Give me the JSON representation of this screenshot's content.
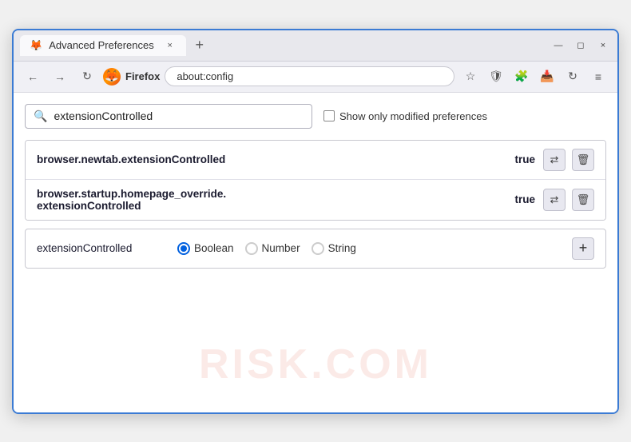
{
  "window": {
    "title": "Advanced Preferences",
    "tab_close": "×",
    "tab_add": "+",
    "win_minimize": "—",
    "win_restore": "◻",
    "win_close": "×"
  },
  "toolbar": {
    "back_label": "←",
    "forward_label": "→",
    "refresh_label": "↻",
    "browser_name": "Firefox",
    "address": "about:config",
    "bookmark_icon": "☆",
    "shield_icon": "🛡",
    "extension_icon": "🧩",
    "downloads_icon": "📥",
    "sync_icon": "↻",
    "menu_icon": "≡"
  },
  "search": {
    "placeholder": "extensionControlled",
    "value": "extensionControlled",
    "show_modified_label": "Show only modified preferences"
  },
  "preferences": [
    {
      "name": "browser.newtab.extensionControlled",
      "value": "true"
    },
    {
      "name_line1": "browser.startup.homepage_override.",
      "name_line2": "extensionControlled",
      "value": "true"
    }
  ],
  "new_pref": {
    "name": "extensionControlled",
    "type_options": [
      "Boolean",
      "Number",
      "String"
    ],
    "selected_type": "Boolean",
    "add_label": "+"
  },
  "icons": {
    "search": "🔍",
    "toggle": "⇄",
    "delete": "🗑",
    "add": "+"
  },
  "watermark": "RISK.COM"
}
